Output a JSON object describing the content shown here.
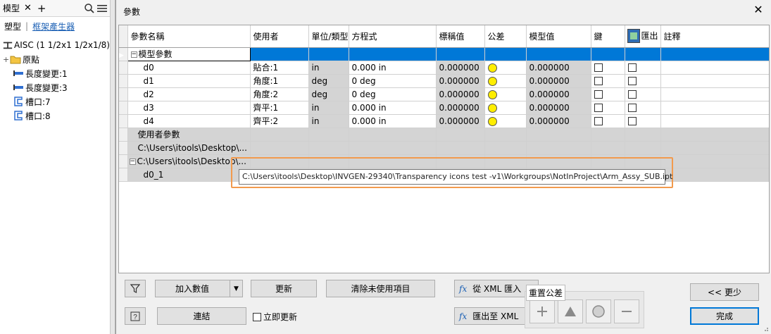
{
  "browser": {
    "tab_label": "模型",
    "close_glyph": "✕",
    "add_glyph": "+",
    "mode_model": "塑型",
    "mode_frame": "框架產生器",
    "root": "AISC (1 1/2x1 1/2x1/8)",
    "items": [
      {
        "label": "原點"
      },
      {
        "label": "長度變更:1"
      },
      {
        "label": "長度變更:3"
      },
      {
        "label": "槽口:7"
      },
      {
        "label": "槽口:8"
      }
    ]
  },
  "dialog": {
    "title": "參數",
    "close_glyph": "✕",
    "columns": {
      "name": "參數名稱",
      "consumer": "使用者",
      "unit": "單位/類型",
      "equation": "方程式",
      "nominal": "標稱值",
      "tolerance": "公差",
      "model": "模型值",
      "key": "鍵",
      "export": "匯出",
      "comment": "註釋"
    },
    "group_model": "模型參數",
    "group_user": "使用者參數",
    "group_file1": "C:\\Users\\itools\\Desktop\\...",
    "group_file2": "C:\\Users\\itools\\Desktop\\...",
    "linked_param": "d0_1",
    "rows": [
      {
        "name": "d0",
        "consumer": "貼合:1",
        "unit": "in",
        "equation": "0.000 in",
        "nominal": "0.000000",
        "model": "0.000000"
      },
      {
        "name": "d1",
        "consumer": "角度:1",
        "unit": "deg",
        "equation": "0 deg",
        "nominal": "0.000000",
        "model": "0.000000"
      },
      {
        "name": "d2",
        "consumer": "角度:2",
        "unit": "deg",
        "equation": "0 deg",
        "nominal": "0.000000",
        "model": "0.000000"
      },
      {
        "name": "d3",
        "consumer": "齊平:1",
        "unit": "in",
        "equation": "0.000 in",
        "nominal": "0.000000",
        "model": "0.000000"
      },
      {
        "name": "d4",
        "consumer": "齊平:2",
        "unit": "in",
        "equation": "0.000 in",
        "nominal": "0.000000",
        "model": "0.000000"
      }
    ],
    "tooltip": "C:\\Users\\itools\\Desktop\\INVGEN-29340\\Transparency icons test -v1\\Workgroups\\NotInProject\\Arm_Assy_SUB.ipt",
    "buttons": {
      "add_value": "加入數值",
      "update": "更新",
      "purge": "清除未使用項目",
      "import_xml": "從 XML 匯入",
      "export_xml": "匯出至 XML",
      "less": "<< 更少",
      "link": "連結",
      "immediate": "立即更新",
      "done": "完成"
    },
    "tolerance_panel": {
      "label": "重置公差"
    }
  },
  "colors": {
    "selection": "#0078d7",
    "tooltip_highlight": "#f29a4d",
    "tolerance_dot": "#ffee00"
  }
}
